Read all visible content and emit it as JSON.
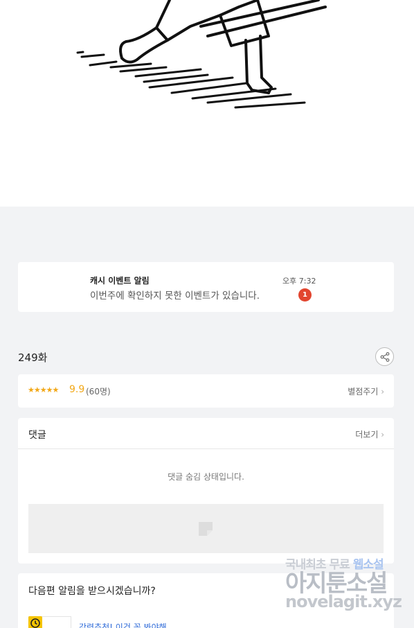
{
  "notice": {
    "title": "캐시 이벤트 알림",
    "message": "이번주에 확인하지 못한 이벤트가 있습니다.",
    "time": "오후 7:32",
    "badge": "1"
  },
  "episode": {
    "title": "249화",
    "share_icon": "share-icon"
  },
  "rating": {
    "stars": "★★★★★",
    "score": "9.9",
    "count": "(60명)",
    "rate_label": "별점주기"
  },
  "comments": {
    "label": "댓글",
    "more_label": "더보기",
    "hidden_message": "댓글 숨김 상태입니다."
  },
  "next_episode": {
    "question": "다음편 알림을 받으시겠습니까?",
    "recommend_text": "강력추천! 이건 꼭 봐야해"
  },
  "watermark": {
    "line1_a": "국내최초 무료",
    "line1_b": "웹소설",
    "line2": "아지툰소설",
    "line3": "novelagit.xyz"
  },
  "colors": {
    "background": "#f2f3f5",
    "card": "#ffffff",
    "star": "#f2a818",
    "badge": "#e2452f",
    "link": "#2f6bd8"
  }
}
